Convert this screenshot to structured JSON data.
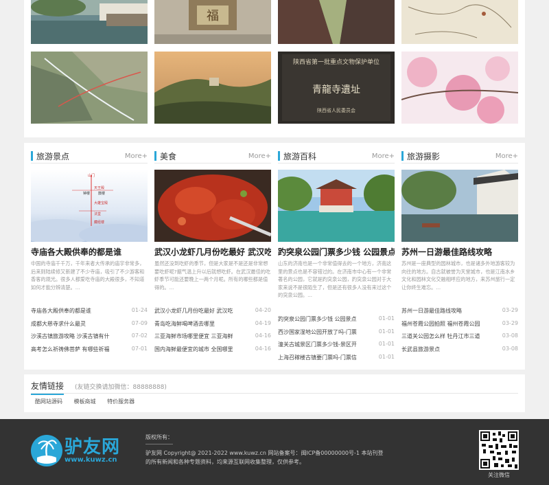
{
  "columns": [
    {
      "title": "旅游景点",
      "more": "More+",
      "headline": "寺庙各大殿供奉的都是谁",
      "summary": "中国的寺庙千千万，千年来者大传承的庙宇非常多，后来则陆续修又新建了不少寺庙，吸引了不少游客和香客的观光。很多人都爱吃寺庙的大殿很多，不知道如何才能分辨清楚。...",
      "list": [
        {
          "t": "寺庙各大殿供奉的都是谁",
          "d": "01-24"
        },
        {
          "t": "成都大慈寺求什么最灵",
          "d": "07-09"
        },
        {
          "t": "沙溪古镇旅游攻略 沙溪古镇有什",
          "d": "07-02"
        },
        {
          "t": "高考怎么祈祷佛菩萨 有哪些祈福",
          "d": "07-01"
        }
      ]
    },
    {
      "title": "美食",
      "more": "More+",
      "headline": "武汉小龙虾几月份吃最好 武汉吃龙",
      "summary": "虽然还没到吃虾的季节，但是大家是不是还是非常想要吃虾呢?据气温上升以后就想吃虾。在武汉最佳的吃虾季节可能还要晚上一两个月呢。所有的哪些都是值得的。...",
      "list": [
        {
          "t": "武汉小龙虾几月份吃最好 武汉吃",
          "d": "04-20"
        },
        {
          "t": "青岛吃海鲜喝啤酒去哪里",
          "d": "04-19"
        },
        {
          "t": "三亚海鲜市场哪里便宜 三亚海鲜",
          "d": "04-16"
        },
        {
          "t": "国内海鲜最便宜的城市 全国哪里",
          "d": "04-16"
        }
      ]
    },
    {
      "title": "旅游百科",
      "more": "More+",
      "headline": "趵突泉公园门票多少钱 公园景点介",
      "summary": "山东的济南也是一个非常值得去的一个地方，济南这里的景点也是不容错过的。在济南市中心有一个非常著名的公园，它就是趵突泉公园，趵突泉公园对于大家来说不是很陌生了，但是还有很多人没有来过这个的突泉公园。...",
      "list": [
        {
          "t": "趵突泉公园门票多少钱 公园景点",
          "d": "01-01"
        },
        {
          "t": "西沙国家湿地公园开放了吗-门票",
          "d": "01-01"
        },
        {
          "t": "潼关古城景区门票多少钱-景区开",
          "d": "01-01"
        },
        {
          "t": "上海召稼楼古镇要门票吗-门票信",
          "d": "01-01"
        }
      ]
    },
    {
      "title": "旅游摄影",
      "more": "More+",
      "headline": "苏州一日游最佳路线攻略",
      "summary": "苏州是一座典型的园林城市，也是诸多外地游客较为向往的地方。自古就被誉为天堂城市，也是江南水乡文化和园林文化交融相呼应的地方，来苏州旅行一定让你终生难忘。...",
      "list": [
        {
          "t": "苏州一日游最佳路线攻略",
          "d": "03-29"
        },
        {
          "t": "福州苍霞公园拍照 福州苍霞公园",
          "d": "03-29"
        },
        {
          "t": "三道关公园怎么样 牡丹江市三道",
          "d": "03-08"
        },
        {
          "t": "长武县旅游景点",
          "d": "03-08"
        }
      ]
    }
  ],
  "map_labels": {
    "top": "山门",
    "tianwang": "天王殿",
    "mahavira": "大雄宝殿",
    "fatang": "法堂",
    "cangjing": "藏经楼",
    "zhonglou": "钟楼",
    "gulou": "鼓楼"
  },
  "stele": {
    "header": "陕西省第一批重点文物保护单位",
    "main": "青龍寺遺址",
    "org": "陕西省人民委员会"
  },
  "fu_char": "福",
  "friends": {
    "title": "友情链接",
    "note": "(友链交换请加微信：88888888)",
    "links": [
      "酷网站源码",
      "模板商城",
      "特价服务器"
    ]
  },
  "footer": {
    "logo_text": "驴友网",
    "logo_url": "www.kuwz.cn",
    "label": "版权所有：",
    "line1": "驴友网 Copyright@ 2021-2022 www.kuwz.cn 网站备案号：闽ICP备00000000号-1 本站刊登",
    "line2": "的所有新闻和各种专题资料，均来源互联网收集整理，仅供参考。",
    "qr_caption": "关注微信"
  },
  "colors": {
    "accent": "#2aa7d8",
    "footer_bg": "#333333"
  }
}
